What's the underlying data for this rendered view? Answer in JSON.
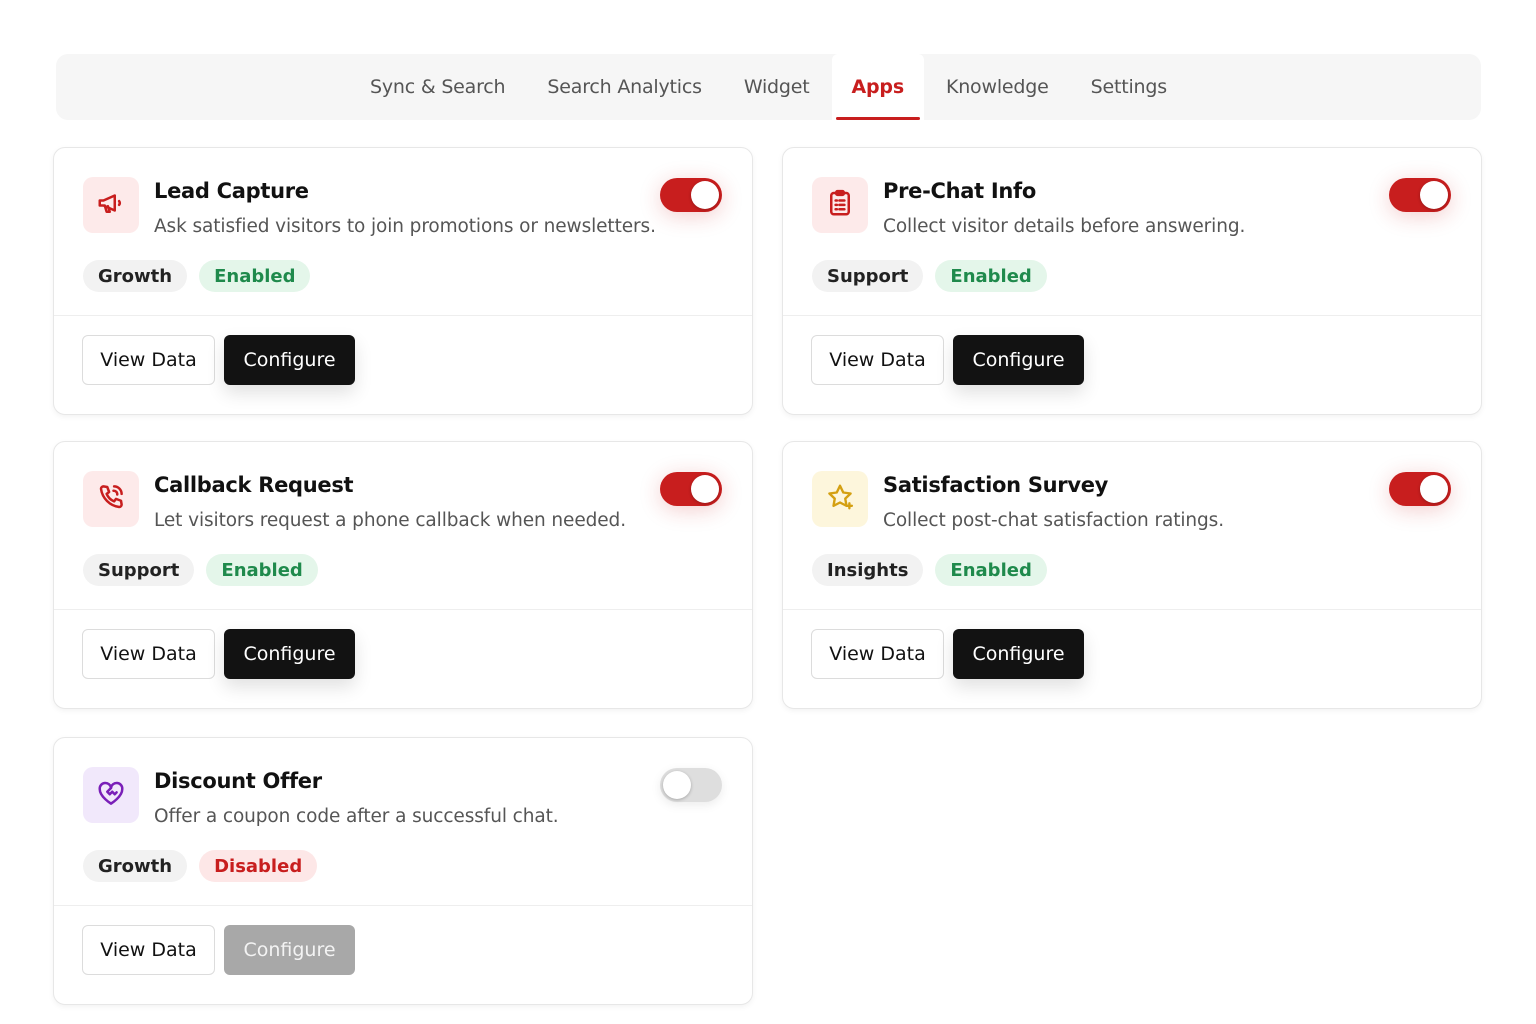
{
  "tabs": [
    {
      "label": "Sync & Search",
      "active": false
    },
    {
      "label": "Search Analytics",
      "active": false
    },
    {
      "label": "Widget",
      "active": false
    },
    {
      "label": "Apps",
      "active": true
    },
    {
      "label": "Knowledge",
      "active": false
    },
    {
      "label": "Settings",
      "active": false
    }
  ],
  "buttons": {
    "view_data": "View Data",
    "configure": "Configure"
  },
  "apps": [
    {
      "title": "Lead Capture",
      "description": "Ask satisfied visitors to join promotions or newsletters.",
      "category": "Growth",
      "status": "Enabled",
      "toggle_on": true,
      "icon": "megaphone-icon",
      "icon_color": "#c81e1e",
      "icon_bg": "#fdeaea"
    },
    {
      "title": "Pre-Chat Info",
      "description": "Collect visitor details before answering.",
      "category": "Support",
      "status": "Enabled",
      "toggle_on": true,
      "icon": "clipboard-icon",
      "icon_color": "#c81e1e",
      "icon_bg": "#fdeaea"
    },
    {
      "title": "Callback Request",
      "description": "Let visitors request a phone callback when needed.",
      "category": "Support",
      "status": "Enabled",
      "toggle_on": true,
      "icon": "phone-ringing-icon",
      "icon_color": "#c81e1e",
      "icon_bg": "#fdeaea"
    },
    {
      "title": "Satisfaction Survey",
      "description": "Collect post-chat satisfaction ratings.",
      "category": "Insights",
      "status": "Enabled",
      "toggle_on": true,
      "icon": "star-sparkle-icon",
      "icon_color": "#d4a012",
      "icon_bg": "#fdf6dc"
    },
    {
      "title": "Discount Offer",
      "description": "Offer a coupon code after a successful chat.",
      "category": "Growth",
      "status": "Disabled",
      "toggle_on": false,
      "icon": "heart-handshake-icon",
      "icon_color": "#7a1fb8",
      "icon_bg": "#f1e8fb"
    }
  ]
}
